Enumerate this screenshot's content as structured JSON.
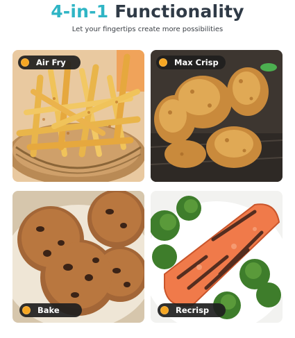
{
  "header": {
    "title_accent": "4-in-1",
    "title_rest": "Functionality",
    "subtitle": "Let your fingertips create more possibilities"
  },
  "colors": {
    "accent": "#2fb5c5",
    "title": "#2f3a46",
    "pill_bg": "#1e1e1e",
    "pill_dot": "#f5a623"
  },
  "cards": [
    {
      "label": "Air Fry",
      "image": "french-fries-basket"
    },
    {
      "label": "Max Crisp",
      "image": "fried-chicken-drumsticks"
    },
    {
      "label": "Bake",
      "image": "chocolate-chip-cookies"
    },
    {
      "label": "Recrisp",
      "image": "grilled-salmon-broccoli"
    }
  ]
}
